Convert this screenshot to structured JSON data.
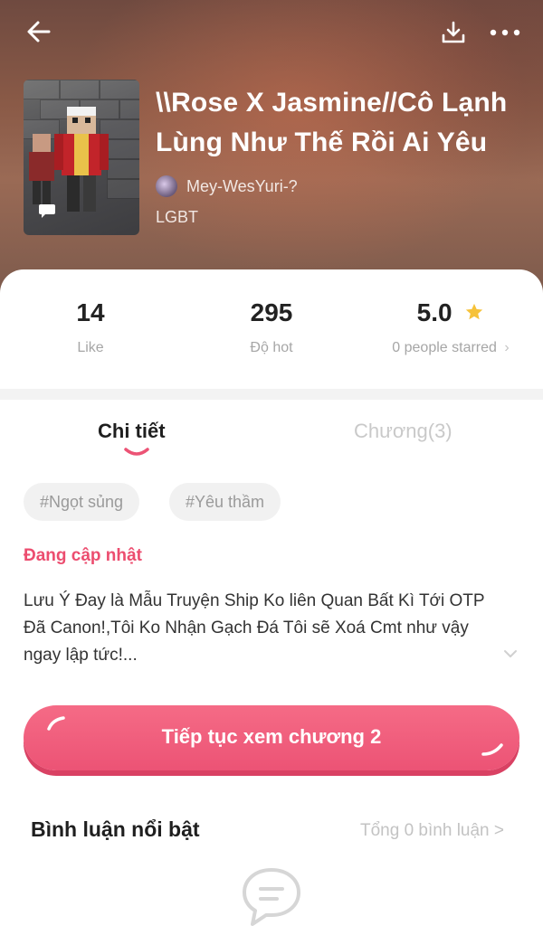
{
  "header": {
    "title": "\\\\Rose X Jasmine//Cô Lạnh Lùng Như Thế Rồi Ai Yêu",
    "author": "Mey-WesYuri-?",
    "category": "LGBT",
    "icons": [
      "back-arrow-icon",
      "download-icon",
      "more-icon"
    ]
  },
  "stats": {
    "like": {
      "value": "14",
      "label": "Like"
    },
    "hot": {
      "value": "295",
      "label": "Độ hot"
    },
    "rating": {
      "value": "5.0",
      "label": "0 people starred",
      "chevron": "›"
    }
  },
  "tabs": [
    {
      "label": "Chi tiết",
      "active": true
    },
    {
      "label": "Chương(3)",
      "active": false
    }
  ],
  "tags": [
    "#Ngọt sủng",
    "#Yêu thầm"
  ],
  "status": "Đang cập nhật",
  "description": "Lưu Ý Đay là Mẫu Truyện Ship Ko liên Quan Bất Kì Tới OTP Đã Canon!,Tôi Ko Nhận Gạch Đá Tôi sẽ Xoá Cmt như vậy ngay lập tức!...",
  "cta_label": "Tiếp tục xem chương 2",
  "comments": {
    "title": "Bình luận nổi bật",
    "total": "Tổng 0 bình luận >"
  },
  "colors": {
    "accent": "#ec5375",
    "status": "#ec4d6f",
    "star": "#f6c23a"
  }
}
